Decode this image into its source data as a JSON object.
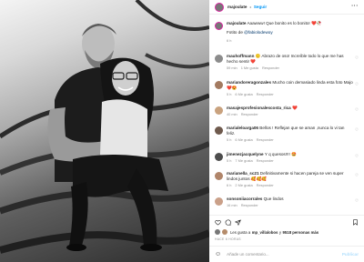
{
  "post": {
    "username": "majoulate",
    "follow_label": "Seguir",
    "caption_text": "Aaawww! Que bonito es lo bonito! ❤️🥀",
    "photo_credit_prefix": "Fotito de",
    "photo_credit_handle": "@fabiolodewoy",
    "caption_time": "6 h"
  },
  "comments": [
    {
      "user": "mauhoffmann",
      "text": "🙂 Abrazo de oso! Increíble todo lo que me has hecho sentir ❤️",
      "time": "59 min",
      "likes": "1 Me gusta",
      "reply": "Responder"
    },
    {
      "user": "mariandoreragonzales",
      "text": "Mucho coin demasiado linda esta foto Majo ❤️😍",
      "time": "5 h",
      "likes": "6 Me gusta",
      "reply": "Responder"
    },
    {
      "user": "masajesprofesionalescosta_rica",
      "text": "❤️",
      "time": "40 min",
      "likes": "",
      "reply": "Responder"
    },
    {
      "user": "marialeloarga06",
      "text": "Bellos ! Reflejan que se aman ,nunca lo vi tan feliz.",
      "time": "5 h",
      "likes": "6 Me gusta",
      "reply": "Responder"
    },
    {
      "user": "jimenezjacquelyne",
      "text": "Y q quesos!!!! 🤩",
      "time": "5 h",
      "likes": "7 Me gusta",
      "reply": "Responder"
    },
    {
      "user": "marianella_sc21",
      "text": "Definitivamente si hacen pareja se ven super lindos juntos 🥰🥰🥰",
      "time": "6 h",
      "likes": "2 Me gusta",
      "reply": "Responder"
    },
    {
      "user": "sonsoniiacorrales",
      "text": "Que lindos",
      "time": "16 min",
      "likes": "",
      "reply": "Responder"
    }
  ],
  "likes": {
    "prefix": "Les gusta a",
    "user": "mp_villalobos",
    "connector": "y",
    "count": "9518 personas más"
  },
  "date": "HACE 6 HORAS",
  "add_comment": {
    "placeholder": "Añade un comentario...",
    "post_label": "Publicar"
  },
  "icons": {
    "like": "heart-outline-icon",
    "comment": "speech-bubble-icon",
    "share": "paper-plane-icon",
    "save": "bookmark-icon",
    "more": "more-dots-icon",
    "emoji": "smiley-icon"
  },
  "colors": {
    "accent": "#0095f6",
    "text": "#262626",
    "muted": "#8e8e8e",
    "heart": "#ed4956",
    "post_disabled": "#b2dffc"
  }
}
